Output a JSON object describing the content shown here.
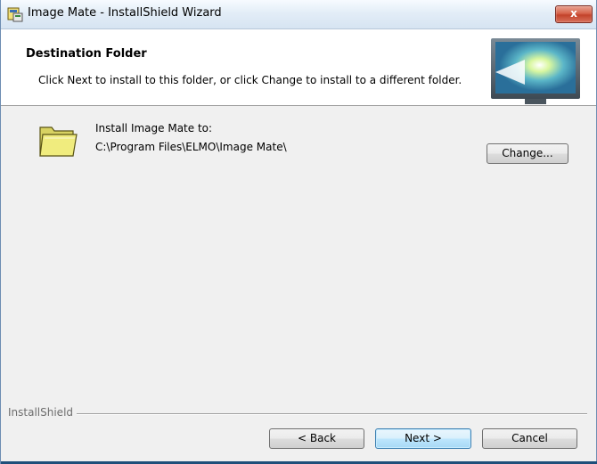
{
  "window": {
    "title": "Image Mate - InstallShield Wizard",
    "close_label": "x"
  },
  "banner": {
    "title": "Destination Folder",
    "description": "Click Next to install to this folder, or click Change to install to a different folder."
  },
  "install": {
    "label": "Install Image Mate to:",
    "path": "C:\\Program Files\\ELMO\\Image Mate\\"
  },
  "buttons": {
    "change": "Change...",
    "back": "< Back",
    "next": "Next >",
    "cancel": "Cancel"
  },
  "footer": {
    "brand": "InstallShield"
  },
  "icons": {
    "app": "installer-icon",
    "folder": "folder-icon",
    "banner": "monitor-icon"
  },
  "colors": {
    "close_button": "#d6634b",
    "default_button_border": "#3c7fb1"
  }
}
